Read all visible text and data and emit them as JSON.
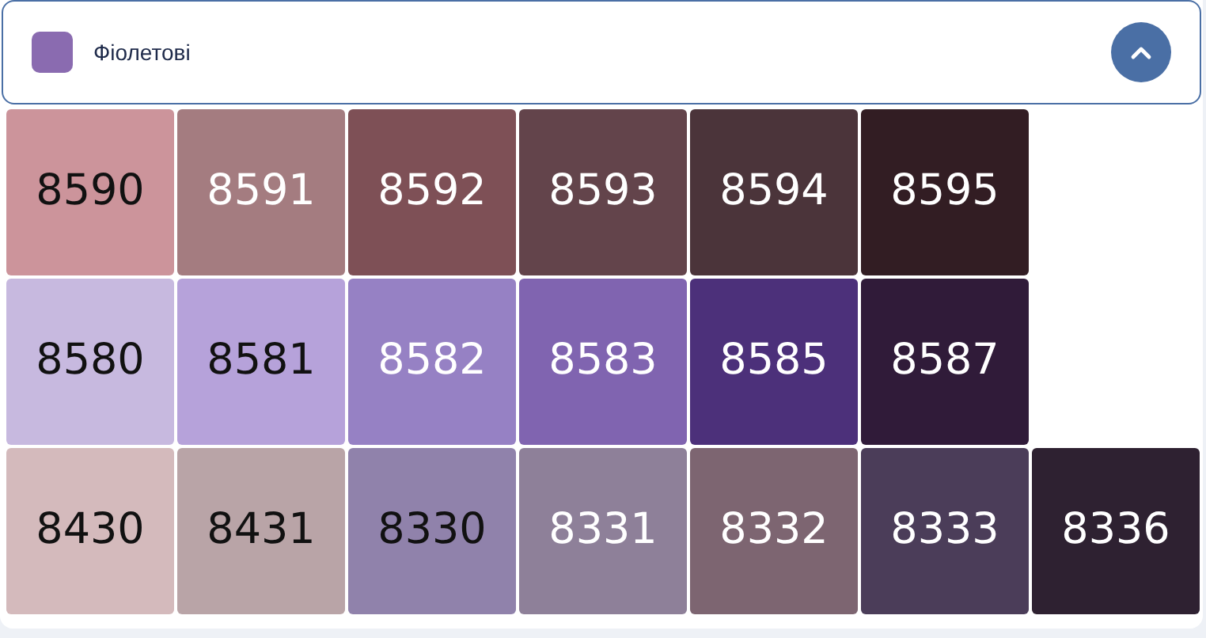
{
  "category": {
    "color": "#8a6bb0",
    "label": "Фіолетові",
    "expanded": true
  },
  "rows": [
    [
      {
        "code": "8590",
        "color": "#cc949b",
        "light_label": false
      },
      {
        "code": "8591",
        "color": "#a47c80",
        "light_label": true
      },
      {
        "code": "8592",
        "color": "#7e5056",
        "light_label": true
      },
      {
        "code": "8593",
        "color": "#63444b",
        "light_label": true
      },
      {
        "code": "8594",
        "color": "#4b343a",
        "light_label": true
      },
      {
        "code": "8595",
        "color": "#321d23",
        "light_label": true
      }
    ],
    [
      {
        "code": "8580",
        "color": "#c7b9df",
        "light_label": false
      },
      {
        "code": "8581",
        "color": "#b6a2da",
        "light_label": false
      },
      {
        "code": "8582",
        "color": "#9681c4",
        "light_label": true
      },
      {
        "code": "8583",
        "color": "#8064b0",
        "light_label": true
      },
      {
        "code": "8585",
        "color": "#4c307a",
        "light_label": true
      },
      {
        "code": "8587",
        "color": "#301b39",
        "light_label": true
      }
    ],
    [
      {
        "code": "8430",
        "color": "#d4babc",
        "light_label": false
      },
      {
        "code": "8431",
        "color": "#b9a4a7",
        "light_label": false
      },
      {
        "code": "8330",
        "color": "#9082ab",
        "light_label": false
      },
      {
        "code": "8331",
        "color": "#8e8099",
        "light_label": true
      },
      {
        "code": "8332",
        "color": "#7d6571",
        "light_label": true
      },
      {
        "code": "8333",
        "color": "#4b3d59",
        "light_label": true
      },
      {
        "code": "8336",
        "color": "#2e2131",
        "light_label": true
      }
    ]
  ]
}
